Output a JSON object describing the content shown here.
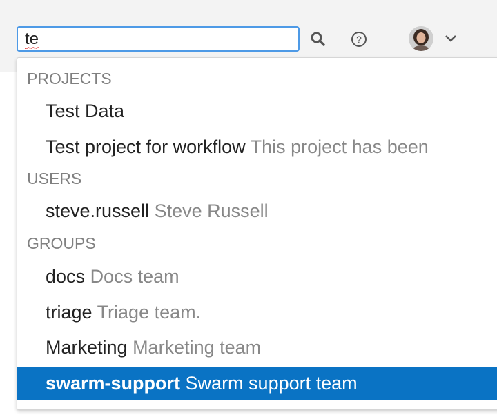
{
  "search": {
    "value": "te"
  },
  "colors": {
    "accent": "#0a73c4",
    "input_border": "#4e9ae6",
    "muted": "#888888"
  },
  "icons": [
    "search-icon",
    "help-icon",
    "avatar",
    "chevron-down-icon"
  ],
  "dropdown": {
    "projects_header": "PROJECTS",
    "projects": [
      {
        "name": "Test Data",
        "description": ""
      },
      {
        "name": "Test project for workflow",
        "description": "This project has been"
      }
    ],
    "users_header": "USERS",
    "users": [
      {
        "name": "steve.russell",
        "description": "Steve Russell"
      }
    ],
    "groups_header": "GROUPS",
    "groups": [
      {
        "name": "docs",
        "description": "Docs team"
      },
      {
        "name": "triage",
        "description": "Triage team."
      },
      {
        "name": "Marketing",
        "description": "Marketing team"
      },
      {
        "name": "swarm-support",
        "description": "Swarm support team"
      }
    ],
    "selected": "swarm-support"
  }
}
